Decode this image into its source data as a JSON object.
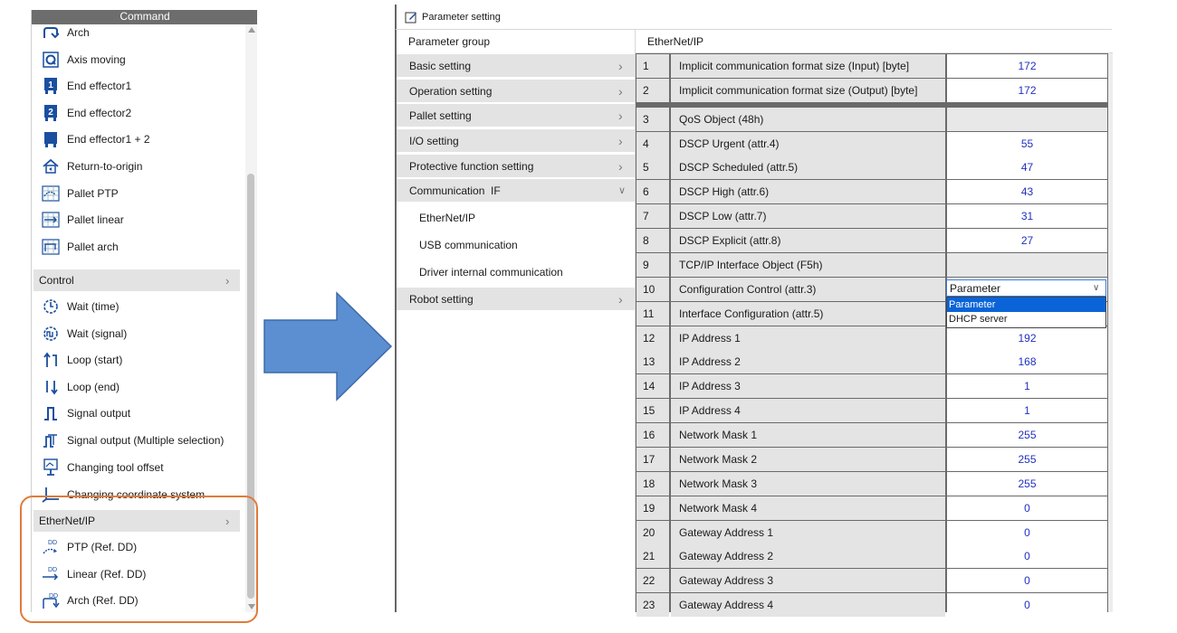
{
  "command_panel": {
    "title": "Command",
    "items": [
      {
        "label": "Arch",
        "icon": "arch-move-icon"
      },
      {
        "label": "Axis moving",
        "icon": "axis-moving-icon"
      },
      {
        "label": "End effector1",
        "icon": "end-effector-1-icon"
      },
      {
        "label": "End effector2",
        "icon": "end-effector-2-icon"
      },
      {
        "label": "End effector1 + 2",
        "icon": "end-effector-both-icon"
      },
      {
        "label": "Return-to-origin",
        "icon": "home-icon"
      },
      {
        "label": "Pallet PTP",
        "icon": "pallet-ptp-icon"
      },
      {
        "label": "Pallet linear",
        "icon": "pallet-linear-icon"
      },
      {
        "label": "Pallet arch",
        "icon": "pallet-arch-icon"
      }
    ],
    "control_category": "Control",
    "control_items": [
      {
        "label": "Wait (time)",
        "icon": "timer-icon"
      },
      {
        "label": "Wait (signal)",
        "icon": "signal-wait-icon"
      },
      {
        "label": "Loop (start)",
        "icon": "loop-start-icon"
      },
      {
        "label": "Loop (end)",
        "icon": "loop-end-icon"
      },
      {
        "label": "Signal output",
        "icon": "pulse-icon"
      },
      {
        "label": "Signal output (Multiple selection)",
        "icon": "multi-pulse-icon"
      },
      {
        "label": "Changing tool offset",
        "icon": "tool-offset-icon"
      },
      {
        "label": "Changing coordinate system",
        "icon": "coordinate-icon"
      }
    ],
    "ethernet_category": "EtherNet/IP",
    "ethernet_items": [
      {
        "label": "PTP (Ref. DD)",
        "icon": "ptp-dd-icon",
        "badge": "DD"
      },
      {
        "label": "Linear (Ref. DD)",
        "icon": "linear-dd-icon",
        "badge": "DD"
      },
      {
        "label": "Arch (Ref. DD)",
        "icon": "arch-dd-icon",
        "badge": "DD"
      }
    ]
  },
  "arrow": {
    "color": "#5b8fd1",
    "icon": "right-arrow-icon"
  },
  "parameter_window": {
    "title": "Parameter setting",
    "group_header": "Parameter group",
    "groups": [
      {
        "label": "Basic setting",
        "expanded": false
      },
      {
        "label": "Operation setting",
        "expanded": false
      },
      {
        "label": "Pallet setting",
        "expanded": false
      },
      {
        "label": "I/O setting",
        "expanded": false
      },
      {
        "label": "Protective function setting",
        "expanded": false
      },
      {
        "label": "Communication  IF",
        "expanded": true
      },
      {
        "label": "Robot setting",
        "expanded": false
      }
    ],
    "communication_subitems": [
      "EtherNet/IP",
      "USB communication",
      "Driver internal communication"
    ],
    "table_header": "EtherNet/IP",
    "rows": [
      {
        "no": "1",
        "name": "Implicit communication format size (Input) [byte]",
        "value": "172"
      },
      {
        "no": "2",
        "name": "Implicit communication format size (Output) [byte]",
        "value": "172"
      },
      {
        "no": "3",
        "name": "QoS Object (48h)",
        "value": ""
      },
      {
        "no": "4",
        "name": "DSCP Urgent (attr.4)",
        "value": "55"
      },
      {
        "no": "5",
        "name": "DSCP Scheduled (attr.5)",
        "value": "47"
      },
      {
        "no": "6",
        "name": "DSCP High (attr.6)",
        "value": "43"
      },
      {
        "no": "7",
        "name": "DSCP Low (attr.7)",
        "value": "31"
      },
      {
        "no": "8",
        "name": "DSCP Explicit (attr.8)",
        "value": "27"
      },
      {
        "no": "9",
        "name": "TCP/IP Interface Object (F5h)",
        "value": ""
      },
      {
        "no": "10",
        "name": "Configuration Control (attr.3)",
        "value": ""
      },
      {
        "no": "11",
        "name": "Interface Configuration (attr.5)",
        "value": ""
      },
      {
        "no": "12",
        "name": "IP Address 1",
        "value": "192"
      },
      {
        "no": "13",
        "name": "IP Address 2",
        "value": "168"
      },
      {
        "no": "14",
        "name": "IP Address 3",
        "value": "1"
      },
      {
        "no": "15",
        "name": "IP Address 4",
        "value": "1"
      },
      {
        "no": "16",
        "name": "Network Mask 1",
        "value": "255"
      },
      {
        "no": "17",
        "name": "Network Mask 2",
        "value": "255"
      },
      {
        "no": "18",
        "name": "Network Mask 3",
        "value": "255"
      },
      {
        "no": "19",
        "name": "Network Mask 4",
        "value": "0"
      },
      {
        "no": "20",
        "name": "Gateway Address 1",
        "value": "0"
      },
      {
        "no": "21",
        "name": "Gateway Address 2",
        "value": "0"
      },
      {
        "no": "22",
        "name": "Gateway Address 3",
        "value": "0"
      },
      {
        "no": "23",
        "name": "Gateway Address 4",
        "value": "0"
      }
    ],
    "dropdown": {
      "selected": "Parameter",
      "options": [
        "Parameter",
        "DHCP server"
      ]
    }
  },
  "colors": {
    "highlight_border": "#e07b39",
    "value_text": "#2030c0",
    "dropdown_selected_bg": "#0a64d8",
    "icon_blue": "#1a4fa0"
  }
}
